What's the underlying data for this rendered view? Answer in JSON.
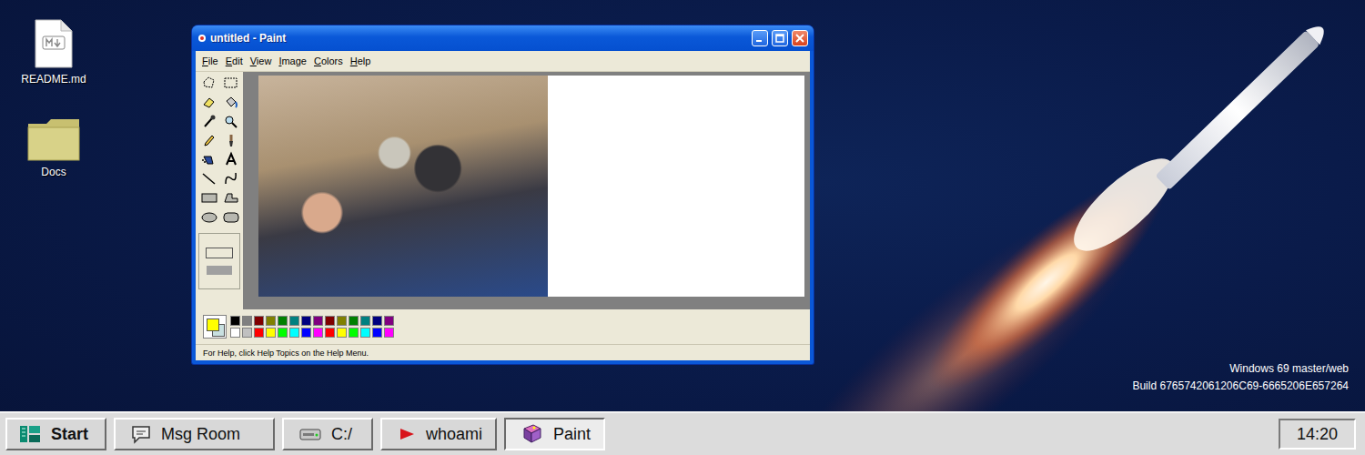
{
  "desktop_icons": [
    {
      "label": "README.md"
    },
    {
      "label": "Docs"
    }
  ],
  "window": {
    "title": "untitled - Paint",
    "menu": [
      "File",
      "Edit",
      "View",
      "Image",
      "Colors",
      "Help"
    ],
    "foreground_color": "#ffff00",
    "background_color": "#c8e0e0",
    "palette": [
      {
        "color": "#000000"
      },
      {
        "color": "#808080"
      },
      {
        "color": "#800000"
      },
      {
        "color": "#808000"
      },
      {
        "color": "#008000"
      },
      {
        "color": "#008080"
      },
      {
        "color": "#000080"
      },
      {
        "color": "#800080"
      },
      {
        "color": "#800000"
      },
      {
        "color": "#808000"
      },
      {
        "color": "#008000"
      },
      {
        "color": "#008080"
      },
      {
        "color": "#000080"
      },
      {
        "color": "#800080"
      },
      {
        "color": "#ffffff"
      },
      {
        "color": "#c0c0c0"
      },
      {
        "color": "#ff0000"
      },
      {
        "color": "#ffff00"
      },
      {
        "color": "#00ff00"
      },
      {
        "color": "#00ffff"
      },
      {
        "color": "#0000ff"
      },
      {
        "color": "#ff00ff"
      },
      {
        "color": "#ff0000"
      },
      {
        "color": "#ffff00"
      },
      {
        "color": "#00ff00"
      },
      {
        "color": "#00ffff"
      },
      {
        "color": "#0000ff"
      },
      {
        "color": "#ff00ff"
      }
    ],
    "status_bar": "For Help, click Help Topics on the Help Menu."
  },
  "system_info": [
    "Windows 69 master/web",
    "Build 6765742061206C69-6665206E657264"
  ],
  "taskbar": {
    "start": "Start",
    "items": [
      {
        "label": "Msg Room",
        "selected": false
      },
      {
        "label": "C:/",
        "selected": false
      },
      {
        "label": "whoami",
        "selected": false
      },
      {
        "label": "Paint",
        "selected": true
      }
    ],
    "clock": "14:20"
  }
}
